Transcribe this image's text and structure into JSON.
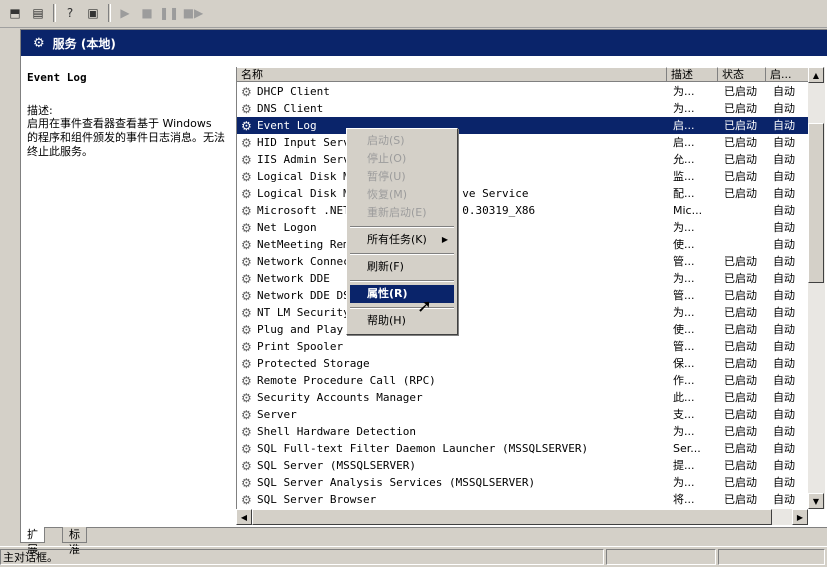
{
  "toolbar": {
    "buttons": [
      "back-icon",
      "forward-icon",
      "help-icon",
      "console-icon",
      "play-icon",
      "stop-icon",
      "pause-icon",
      "restart-icon"
    ]
  },
  "header": {
    "title": "服务 (本地)",
    "icon": "services-icon"
  },
  "left": {
    "service_name": "Event Log",
    "desc_label": "描述:",
    "description": "启用在事件查看器查看基于 Windows 的程序和组件颁发的事件日志消息。无法终止此服务。"
  },
  "columns": [
    "名称",
    "描述",
    "状态",
    "启..."
  ],
  "rows": [
    {
      "name": "DHCP Client",
      "desc": "为...",
      "status": "已启动",
      "start": "自动"
    },
    {
      "name": "DNS Client",
      "desc": "为...",
      "status": "已启动",
      "start": "自动"
    },
    {
      "name": "Event Log",
      "desc": "启...",
      "status": "已启动",
      "start": "自动",
      "selected": true
    },
    {
      "name": "HID Input Servi",
      "desc": "启...",
      "status": "已启动",
      "start": "自动"
    },
    {
      "name": "IIS Admin Servi",
      "desc": "允...",
      "status": "已启动",
      "start": "自动"
    },
    {
      "name": "Logical Disk Ma",
      "desc": "监...",
      "status": "已启动",
      "start": "自动"
    },
    {
      "name": "Logical Disk Ma                ve Service",
      "desc": "配...",
      "status": "已启动",
      "start": "自动"
    },
    {
      "name": "Microsoft .NET                 0.30319_X86",
      "desc": "Mic...",
      "status": "",
      "start": "自动"
    },
    {
      "name": "Net Logon",
      "desc": "为...",
      "status": "",
      "start": "自动"
    },
    {
      "name": "NetMeeting Remo",
      "desc": "使...",
      "status": "",
      "start": "自动"
    },
    {
      "name": "Network Connect",
      "desc": "管...",
      "status": "已启动",
      "start": "自动"
    },
    {
      "name": "Network DDE",
      "desc": "为...",
      "status": "已启动",
      "start": "自动"
    },
    {
      "name": "Network DDE DSD",
      "desc": "管...",
      "status": "已启动",
      "start": "自动"
    },
    {
      "name": "NT LM Security",
      "desc": "为...",
      "status": "已启动",
      "start": "自动"
    },
    {
      "name": "Plug and Play",
      "desc": "使...",
      "status": "已启动",
      "start": "自动"
    },
    {
      "name": "Print Spooler",
      "desc": "管...",
      "status": "已启动",
      "start": "自动"
    },
    {
      "name": "Protected Storage",
      "desc": "保...",
      "status": "已启动",
      "start": "自动"
    },
    {
      "name": "Remote Procedure Call (RPC)",
      "desc": "作...",
      "status": "已启动",
      "start": "自动"
    },
    {
      "name": "Security Accounts Manager",
      "desc": "此...",
      "status": "已启动",
      "start": "自动"
    },
    {
      "name": "Server",
      "desc": "支...",
      "status": "已启动",
      "start": "自动"
    },
    {
      "name": "Shell Hardware Detection",
      "desc": "为...",
      "status": "已启动",
      "start": "自动"
    },
    {
      "name": "SQL Full-text Filter Daemon Launcher (MSSQLSERVER)",
      "desc": "Ser...",
      "status": "已启动",
      "start": "自动"
    },
    {
      "name": "SQL Server (MSSQLSERVER)",
      "desc": "提...",
      "status": "已启动",
      "start": "自动"
    },
    {
      "name": "SQL Server Analysis Services (MSSQLSERVER)",
      "desc": "为...",
      "status": "已启动",
      "start": "自动"
    },
    {
      "name": "SQL Server Browser",
      "desc": "将...",
      "status": "已启动",
      "start": "自动"
    }
  ],
  "context_menu": {
    "items": [
      {
        "label": "启动(S)",
        "disabled": true
      },
      {
        "label": "停止(O)",
        "disabled": true
      },
      {
        "label": "暂停(U)",
        "disabled": true
      },
      {
        "label": "恢复(M)",
        "disabled": true
      },
      {
        "label": "重新启动(E)",
        "disabled": true
      },
      {
        "label": "所有任务(K)",
        "submenu": true
      },
      {
        "label": "刷新(F)"
      },
      {
        "label": "属性(R)",
        "highlighted": true
      },
      {
        "label": "帮助(H)"
      }
    ]
  },
  "tabs": [
    "扩展",
    "标准"
  ],
  "status": {
    "text": "主对话框。"
  }
}
